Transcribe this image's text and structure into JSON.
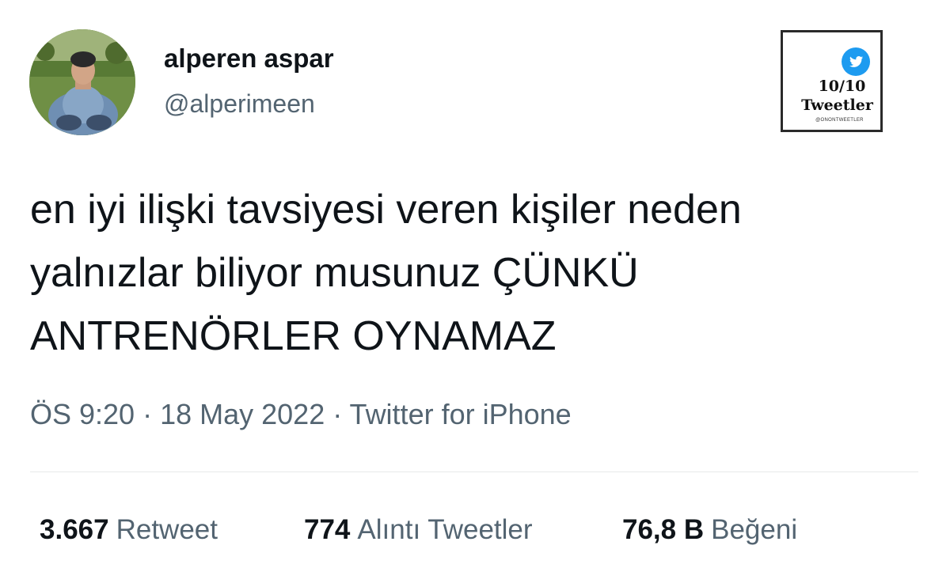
{
  "user": {
    "display_name": "alperen aspar",
    "handle": "@alperimeen"
  },
  "watermark": {
    "icon": "twitter-bird-icon",
    "score": "10/10",
    "title": "Tweetler",
    "handle": "@ONONTWEETLER",
    "brand_color": "#1d9bf0"
  },
  "tweet": {
    "lines": [
      "en iyi ilişki tavsiyesi veren kişiler neden",
      "yalnızlar biliyor musunuz ÇÜNKÜ",
      "ANTRENÖRLER OYNAMAZ"
    ],
    "meta": "ÖS 9:20 · 18 May 2022 · Twitter for iPhone"
  },
  "stats": {
    "retweets": {
      "value": "3.667",
      "label": "Retweet"
    },
    "quotes": {
      "value": "774",
      "label": "Alıntı Tweetler"
    },
    "likes": {
      "value": "76,8 B",
      "label": "Beğeni"
    }
  },
  "colors": {
    "text_primary": "#0f1419",
    "text_secondary": "#536471",
    "divider": "#e7e9ea"
  }
}
